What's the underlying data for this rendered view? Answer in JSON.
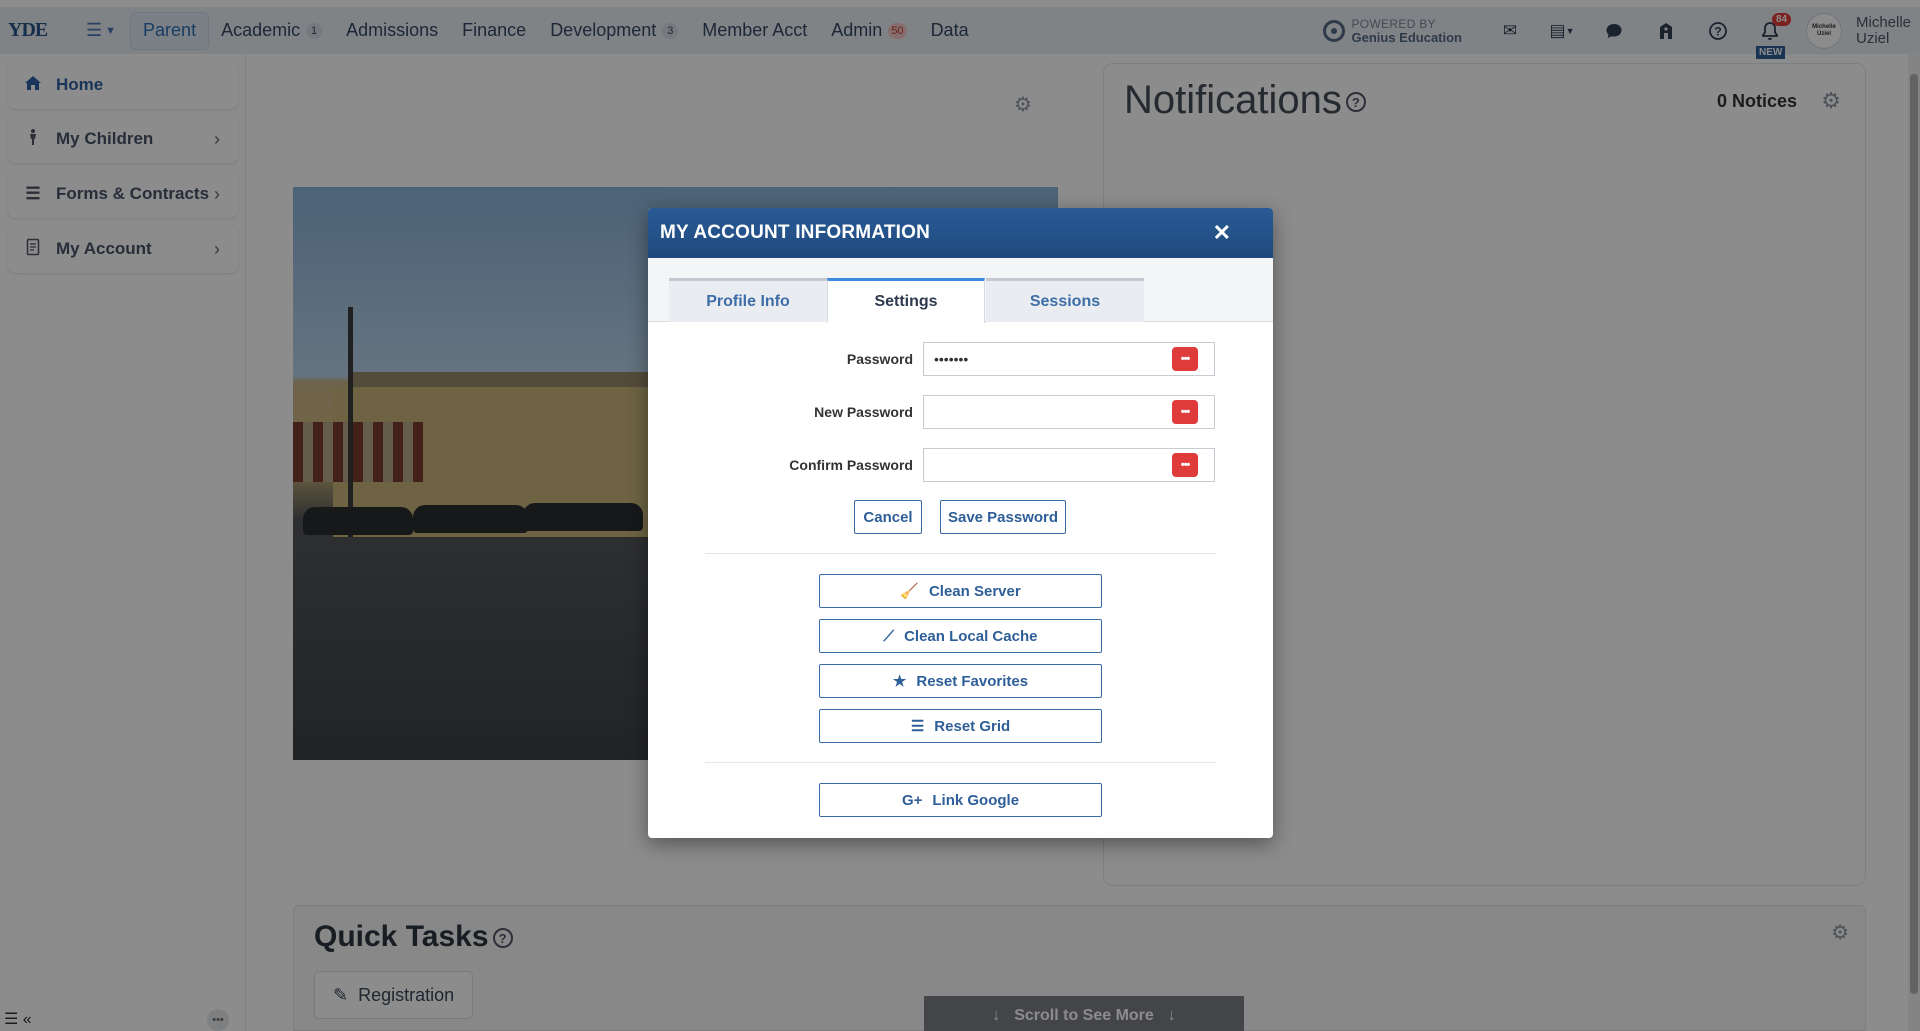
{
  "topbar": {
    "logo": "YDE",
    "nav": [
      {
        "label": "Parent",
        "badge": "",
        "active": true
      },
      {
        "label": "Academic",
        "badge": "1"
      },
      {
        "label": "Admissions",
        "badge": ""
      },
      {
        "label": "Finance",
        "badge": ""
      },
      {
        "label": "Development",
        "badge": "3"
      },
      {
        "label": "Member Acct",
        "badge": ""
      },
      {
        "label": "Admin",
        "badge": "50",
        "badge_color": "red"
      },
      {
        "label": "Data",
        "badge": ""
      }
    ],
    "powered_small": "POWERED BY",
    "powered_big": "Genius Education",
    "notification_count": "84",
    "new_label": "NEW",
    "avatar_line1": "Michelle",
    "avatar_line2": "Uziel",
    "user_first": "Michelle",
    "user_last": "Uziel"
  },
  "sidebar": {
    "items": [
      {
        "label": "Home",
        "icon": "home-icon",
        "active": true
      },
      {
        "label": "My Children",
        "icon": "child-icon"
      },
      {
        "label": "Forms & Contracts",
        "icon": "list-icon"
      },
      {
        "label": "My Account",
        "icon": "document-icon"
      }
    ]
  },
  "notifications": {
    "title": "Notifications",
    "count_label": "0 Notices"
  },
  "quick_tasks": {
    "title": "Quick Tasks",
    "registration_label": "Registration",
    "scroll_label": "Scroll to See More"
  },
  "modal": {
    "title": "MY ACCOUNT INFORMATION",
    "tabs": [
      {
        "label": "Profile Info"
      },
      {
        "label": "Settings",
        "active": true
      },
      {
        "label": "Sessions"
      }
    ],
    "password": {
      "label": "Password",
      "value": "•••••••"
    },
    "new_password": {
      "label": "New Password",
      "value": ""
    },
    "confirm_password": {
      "label": "Confirm Password",
      "value": ""
    },
    "cancel_label": "Cancel",
    "save_password_label": "Save Password",
    "clean_server_label": "Clean Server",
    "clean_cache_label": "Clean Local Cache",
    "reset_favorites_label": "Reset Favorites",
    "reset_grid_label": "Reset Grid",
    "link_google_label": "Link Google",
    "pw_toggle_label": "•••"
  },
  "colors": {
    "header_blue": "#1e4a7e",
    "accent_blue": "#2f5f98",
    "danger_red": "#e03b3b"
  }
}
